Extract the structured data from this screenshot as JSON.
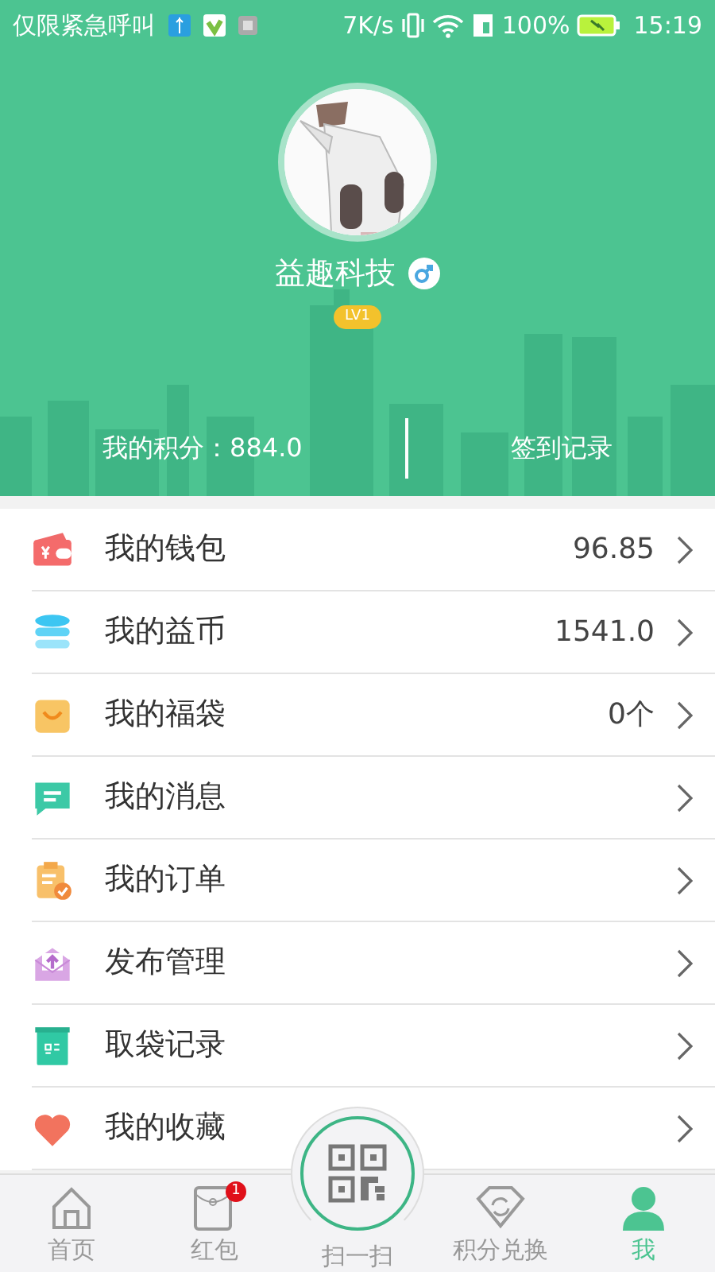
{
  "status_bar": {
    "carrier": "仅限紧急呼叫",
    "speed": "7K/s",
    "battery": "100%",
    "time": "15:19"
  },
  "profile": {
    "name": "益趣科技",
    "level": "LV1"
  },
  "stats": [
    {
      "label": "我的积分：884.0"
    },
    {
      "label": "签到记录"
    }
  ],
  "menu": [
    {
      "kind": "wallet",
      "label": "我的钱包",
      "value": "96.85"
    },
    {
      "kind": "coins",
      "label": "我的益币",
      "value": "1541.0"
    },
    {
      "kind": "bag",
      "label": "我的福袋",
      "value": "0个"
    },
    {
      "kind": "message",
      "label": "我的消息"
    },
    {
      "kind": "order",
      "label": "我的订单"
    },
    {
      "kind": "publish",
      "label": "发布管理"
    },
    {
      "kind": "record",
      "label": "取袋记录"
    },
    {
      "kind": "favorite",
      "label": "我的收藏"
    }
  ],
  "tab_bar": [
    {
      "kind": "home",
      "label": "首页",
      "selected": false
    },
    {
      "kind": "redpacket",
      "label": "红包",
      "selected": false,
      "badge": "1"
    },
    {
      "kind": "scan",
      "label": "扫一扫",
      "selected": false
    },
    {
      "kind": "exchange",
      "label": "积分兑换",
      "selected": false
    },
    {
      "kind": "me",
      "label": "我",
      "selected": true
    }
  ]
}
